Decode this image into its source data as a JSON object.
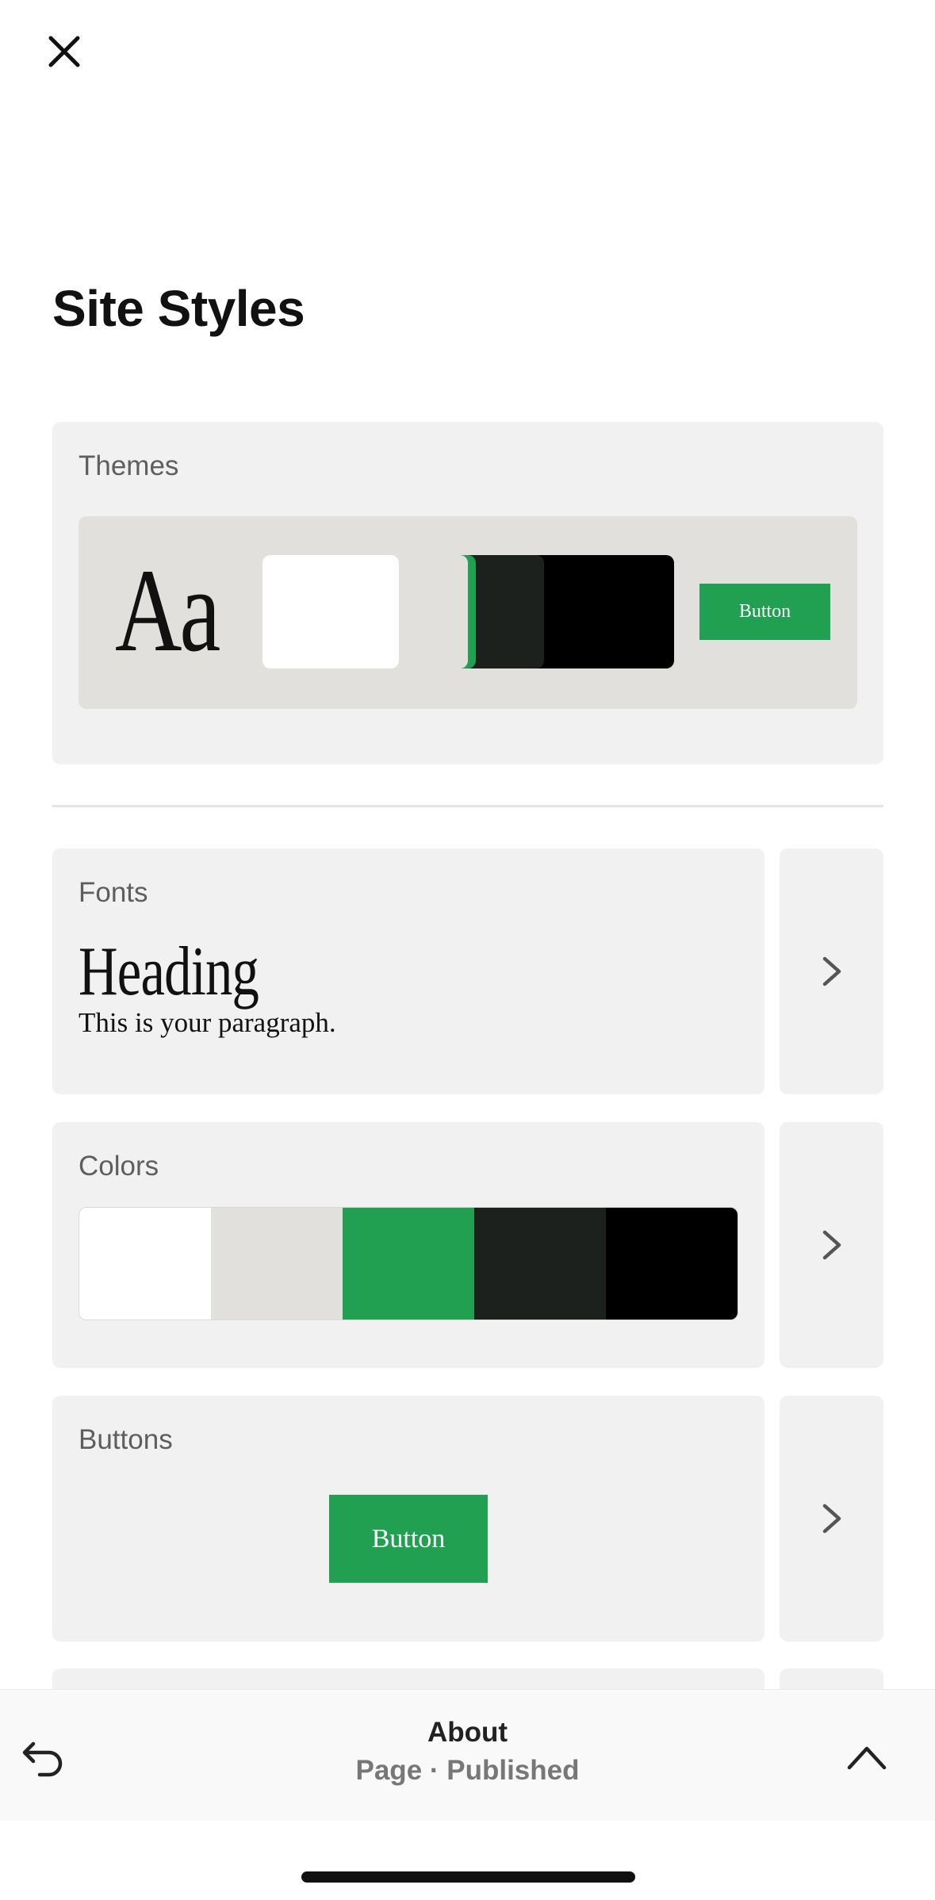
{
  "header": {
    "close_icon": "close-icon"
  },
  "page_title": "Site Styles",
  "themes": {
    "label": "Themes",
    "font_sample": "Aa",
    "swatches": [
      "#ffffff",
      "#e1e0dc",
      "#21a052",
      "#1d211e",
      "#000000"
    ],
    "button_label": "Button"
  },
  "fonts": {
    "label": "Fonts",
    "heading_sample": "Heading",
    "paragraph_sample": "This is your paragraph."
  },
  "colors": {
    "label": "Colors",
    "palette": [
      "#ffffff",
      "#e1e0dc",
      "#21a052",
      "#1d211e",
      "#000000"
    ]
  },
  "buttons": {
    "label": "Buttons",
    "button_label": "Button"
  },
  "bottom_bar": {
    "page_name": "About",
    "page_status": "Page · Published"
  },
  "theme_colors": {
    "accent": "#21a052",
    "card_bg": "#f1f1f1",
    "preview_bg": "#e1e0dc"
  }
}
